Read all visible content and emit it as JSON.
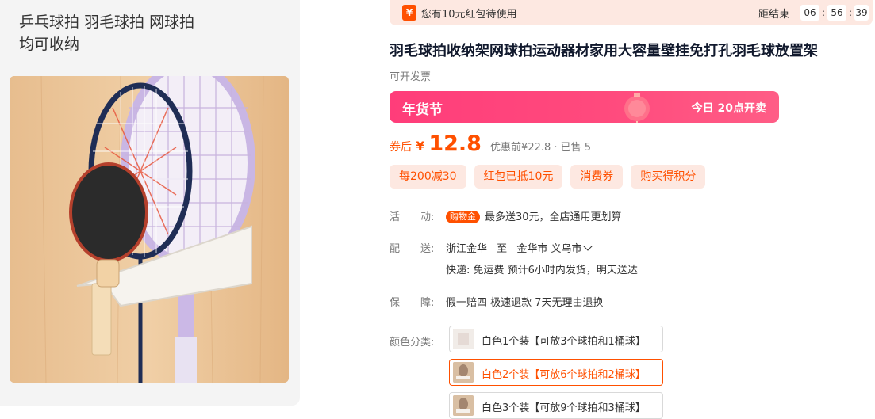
{
  "gallery": {
    "caption_line1": "乒乓球拍 羽毛球拍 网球拍",
    "caption_line2": "均可收纳"
  },
  "coupon_bar": {
    "icon_char": "¥",
    "message": "您有10元红包待使用",
    "countdown_label": "距结束",
    "hours": "06",
    "minutes": "56",
    "seconds": "39"
  },
  "product": {
    "title": "羽毛球拍收纳架网球拍运动器材家用大容量壁挂免打孔羽毛球放置架",
    "invoice": "可开发票"
  },
  "festival": {
    "label": "年货节",
    "sale_text": "今日 20点开卖"
  },
  "price": {
    "label": "券后",
    "currency": "¥",
    "value": "12.8",
    "meta": "优惠前¥22.8 · 已售 5"
  },
  "promo_tags": [
    "每200减30",
    "红包已抵10元",
    "消费券",
    "购买得积分"
  ],
  "activity": {
    "label": "活　　动:",
    "badge": "购物金",
    "text": "最多送30元，全店通用更划算"
  },
  "delivery": {
    "label": "配　　送:",
    "from": "浙江金华",
    "to_word": "至",
    "to": "金华市 义乌市",
    "detail": "快递: 免运费  预计6小时内发货，明天送达"
  },
  "guarantee": {
    "label": "保　　障:",
    "text": "假一赔四 极速退款 7天无理由退换"
  },
  "sku": {
    "label": "颜色分类:",
    "options": [
      {
        "text": "白色1个装【可放3个球拍和1桶球】",
        "selected": false
      },
      {
        "text": "白色2个装【可放6个球拍和2桶球】",
        "selected": true
      },
      {
        "text": "白色3个装【可放9个球拍和3桶球】",
        "selected": false
      }
    ]
  },
  "colors": {
    "accent": "#ff5000",
    "festival_pink": "#ff3d7a",
    "tag_bg": "#fde8e1"
  }
}
